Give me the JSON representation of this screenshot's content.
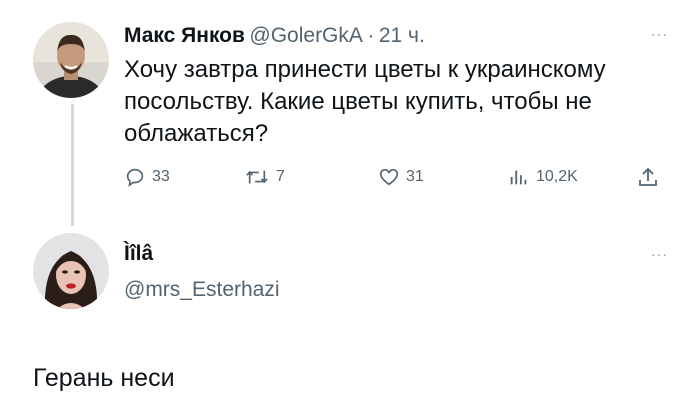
{
  "tweet": {
    "author_name": "Макс Янков",
    "handle": "@GolerGkA",
    "separator": "·",
    "time": "21 ч.",
    "text": "Хочу завтра принести цветы к украинскому посольству. Какие цветы купить, чтобы не облажаться?",
    "more": "···",
    "actions": {
      "replies": "33",
      "retweets": "7",
      "likes": "31",
      "views": "10,2K"
    }
  },
  "reply": {
    "author_name": "Ìîlâ",
    "handle": "@mrs_Esterhazi",
    "more": "···",
    "text": "Герань неси"
  },
  "icons": {
    "reply": "speech-bubble-icon",
    "retweet": "retweet-arrows-icon",
    "like": "heart-icon",
    "views": "bar-chart-icon",
    "share": "share-upload-icon"
  },
  "colors": {
    "text": "#0f1419",
    "secondary": "#536471",
    "thread_line": "#cfd9de"
  }
}
